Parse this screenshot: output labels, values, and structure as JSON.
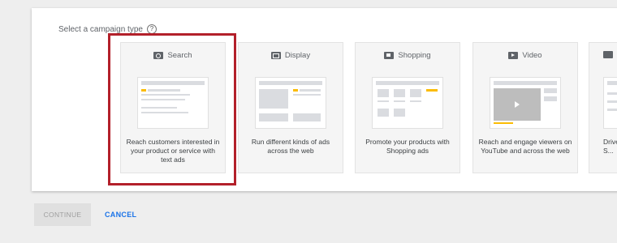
{
  "header": {
    "label": "Select a campaign type",
    "help_icon": "help-icon"
  },
  "cards": [
    {
      "title": "Search",
      "icon": "search-icon",
      "description": "Reach customers interested in your product or service with text ads",
      "selected": true
    },
    {
      "title": "Display",
      "icon": "display-icon",
      "description": "Run different kinds of ads across the web",
      "selected": false
    },
    {
      "title": "Shopping",
      "icon": "shopping-icon",
      "description": "Promote your products with Shopping ads",
      "selected": false
    },
    {
      "title": "Video",
      "icon": "video-icon",
      "description": "Reach and engage viewers on YouTube and across the web",
      "selected": false
    },
    {
      "title": "",
      "icon": "app-icon",
      "description": "Drive a... S...",
      "selected": false
    }
  ],
  "actions": {
    "continue_label": "CONTINUE",
    "cancel_label": "CANCEL"
  },
  "colors": {
    "highlight": "#b3202a",
    "accent_yellow": "#fbbc04",
    "link_blue": "#1a73e8"
  }
}
